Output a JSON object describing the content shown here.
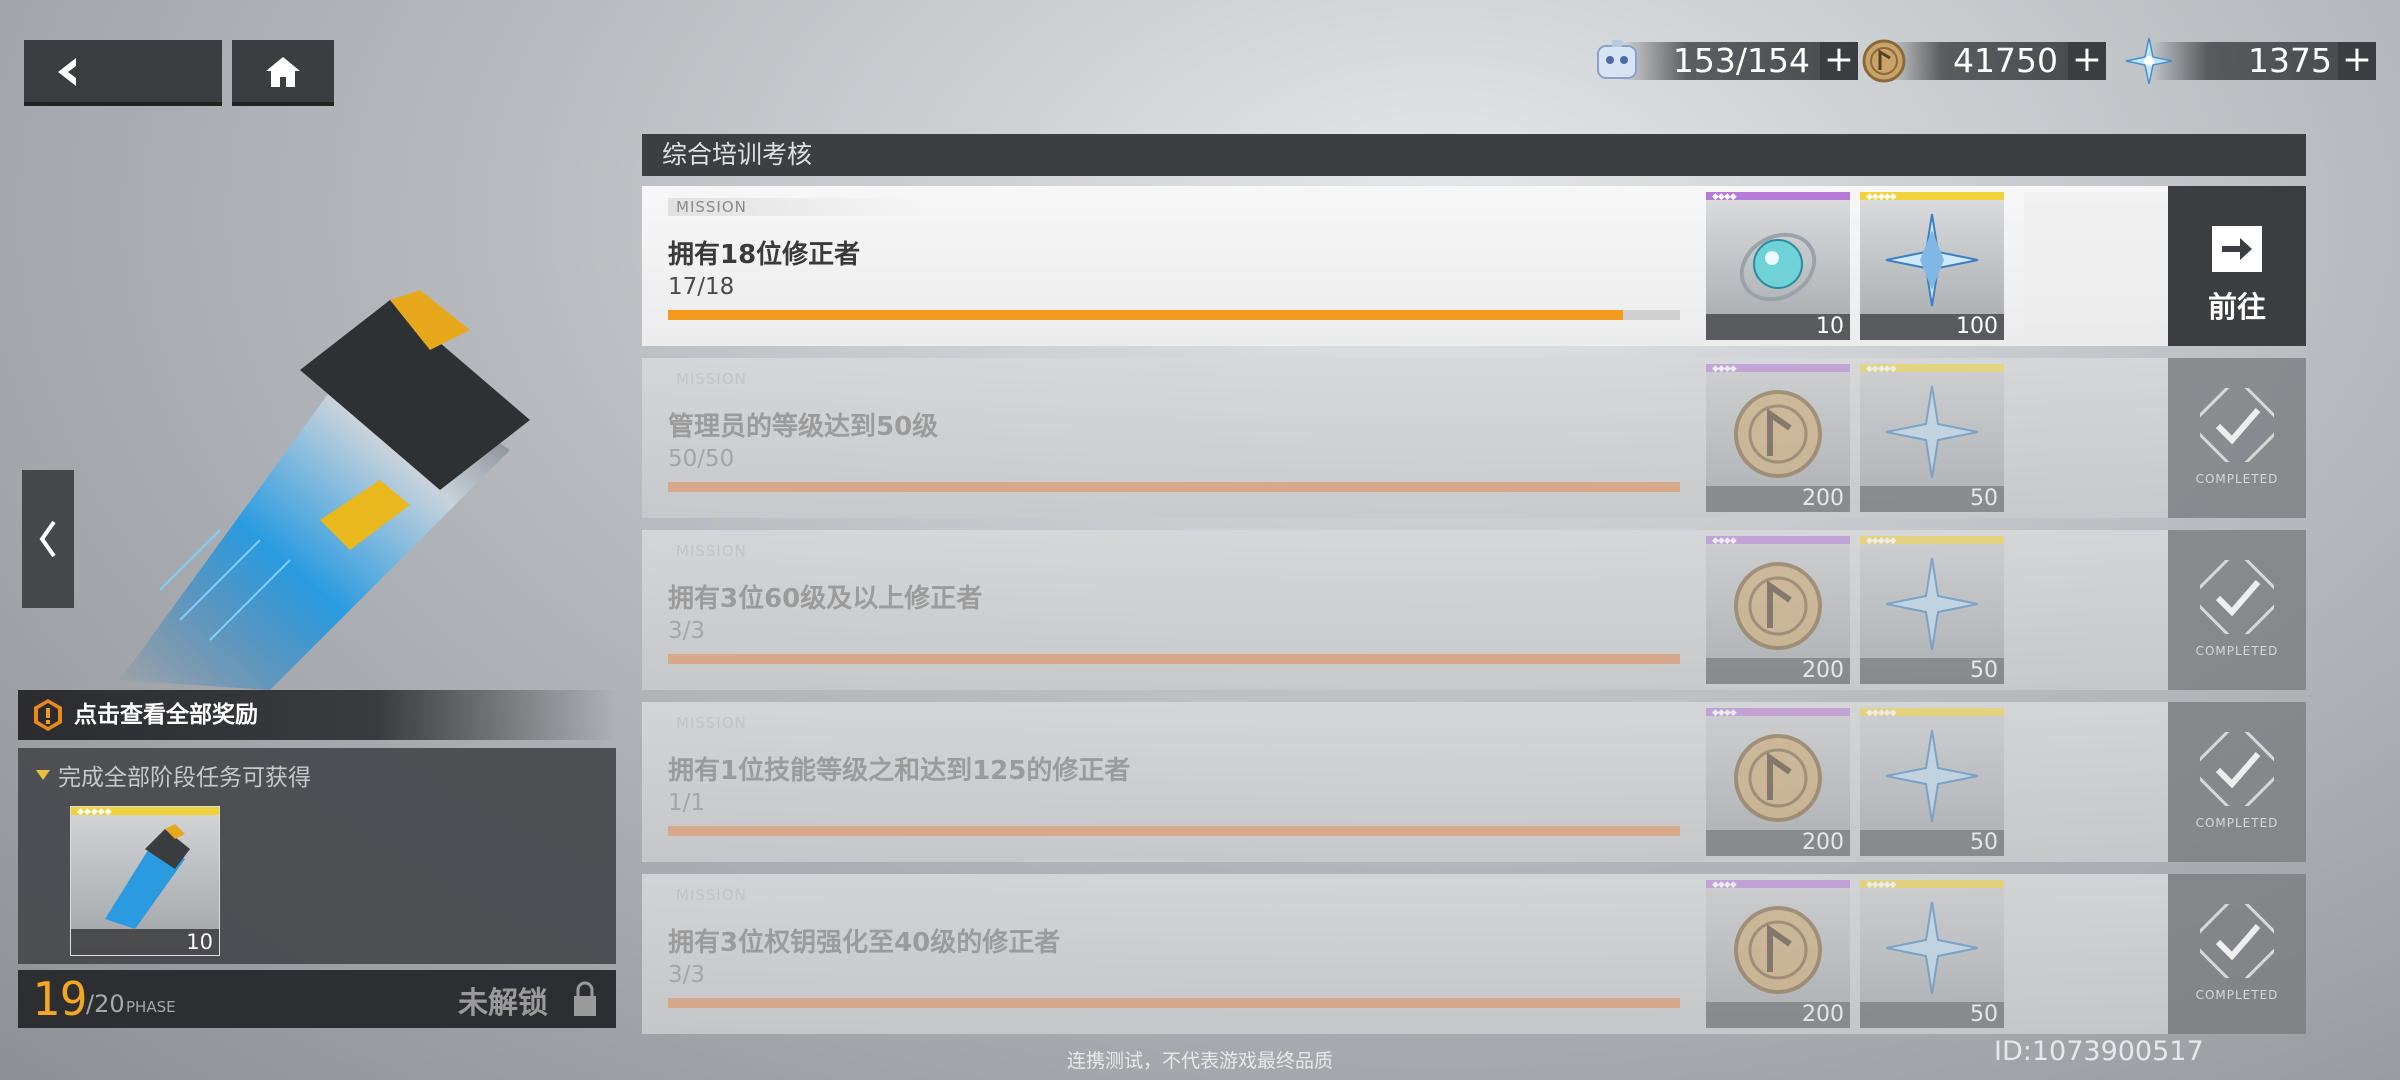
{
  "currencies": [
    {
      "icon": "energy-robot-icon",
      "value": "153/154"
    },
    {
      "icon": "gold-coin-icon",
      "value": "41750"
    },
    {
      "icon": "crystal-star-icon",
      "value": "1375"
    }
  ],
  "section_title": "综合培训考核",
  "mission_tag": "MISSION",
  "missions": [
    {
      "title": "拥有18位修正者",
      "progress_text": "17/18",
      "progress": 0.944,
      "status": "active",
      "action_label": "前往",
      "rewards": [
        {
          "icon": "crystal-orb-icon",
          "count": "10",
          "rarity": "purple"
        },
        {
          "icon": "crystal-star-icon",
          "count": "100",
          "rarity": "gold"
        }
      ]
    },
    {
      "title": "管理员的等级达到50级",
      "progress_text": "50/50",
      "progress": 1,
      "status": "completed",
      "status_label": "COMPLETED",
      "rewards": [
        {
          "icon": "gold-coin-icon",
          "count": "200",
          "rarity": "purple"
        },
        {
          "icon": "crystal-star-icon",
          "count": "50",
          "rarity": "gold"
        }
      ]
    },
    {
      "title": "拥有3位60级及以上修正者",
      "progress_text": "3/3",
      "progress": 1,
      "status": "completed",
      "status_label": "COMPLETED",
      "rewards": [
        {
          "icon": "gold-coin-icon",
          "count": "200",
          "rarity": "purple"
        },
        {
          "icon": "crystal-star-icon",
          "count": "50",
          "rarity": "gold"
        }
      ]
    },
    {
      "title": "拥有1位技能等级之和达到125的修正者",
      "progress_text": "1/1",
      "progress": 1,
      "status": "completed",
      "status_label": "COMPLETED",
      "rewards": [
        {
          "icon": "gold-coin-icon",
          "count": "200",
          "rarity": "purple"
        },
        {
          "icon": "crystal-star-icon",
          "count": "50",
          "rarity": "gold"
        }
      ]
    },
    {
      "title": "拥有3位权钥强化至40级的修正者",
      "progress_text": "3/3",
      "progress": 1,
      "status": "completed",
      "status_label": "COMPLETED",
      "rewards": [
        {
          "icon": "gold-coin-icon",
          "count": "200",
          "rarity": "purple"
        },
        {
          "icon": "crystal-star-icon",
          "count": "50",
          "rarity": "gold"
        }
      ]
    }
  ],
  "left": {
    "view_all": "点击查看全部奖励",
    "final_sub": "完成全部阶段任务可获得",
    "final_reward": {
      "icon": "key-card-icon",
      "count": "10"
    },
    "phase_current": "19",
    "phase_total": "/20",
    "phase_label": "PHASE",
    "lock_text": "未解锁"
  },
  "footer_notice": "连携测试，不代表游戏最终品质",
  "user_id": "ID:1073900517",
  "colors": {
    "accent": "#f39a1f",
    "purple": "#b57bd6",
    "gold": "#f0d23a"
  }
}
